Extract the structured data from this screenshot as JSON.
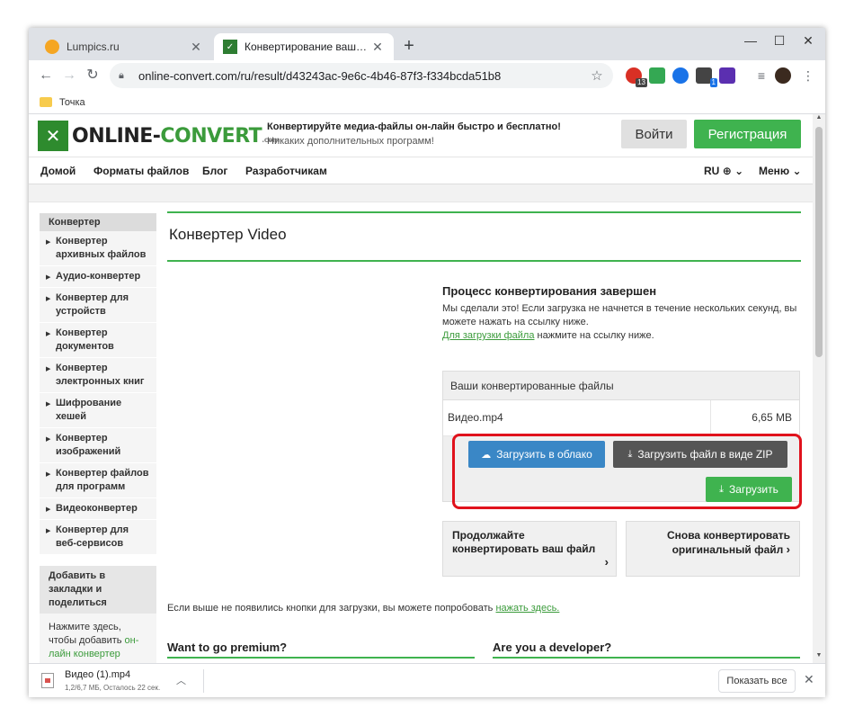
{
  "browser": {
    "tabs": [
      {
        "title": "Lumpics.ru",
        "active": false
      },
      {
        "title": "Конвертирование ваших файлов",
        "active": true
      }
    ],
    "new_tab": "+",
    "window_controls": {
      "minimize": "—",
      "maximize": "☐",
      "close": "✕"
    },
    "url": "online-convert.com/ru/result/d43243ac-9e6c-4b46-87f3-f334bcda51b8",
    "extension_badges": {
      "first": "13",
      "second": "1"
    },
    "bookmarks": [
      {
        "label": "Точка"
      }
    ]
  },
  "site": {
    "logo": {
      "part1": "ONLINE-",
      "part2": "CONVERT",
      "suffix": ".com"
    },
    "tagline_main": "Конвертируйте медиа-файлы он-лайн быстро и бесплатно!",
    "tagline_sub": "Никаких дополнительных программ!",
    "login_label": "Войти",
    "register_label": "Регистрация",
    "nav": {
      "home": "Домой",
      "formats": "Форматы файлов",
      "blog": "Блог",
      "developers": "Разработчикам",
      "lang": "RU",
      "menu": "Меню"
    }
  },
  "sidebar": {
    "heading": "Конвертер",
    "items": [
      {
        "label": "Конвертер архивных файлов"
      },
      {
        "label": "Аудио-конвертер"
      },
      {
        "label": "Конвертер для устройств"
      },
      {
        "label": "Конвертер документов"
      },
      {
        "label": "Конвертер электронных книг"
      },
      {
        "label": "Шифрование хешей"
      },
      {
        "label": "Конвертер изображений"
      },
      {
        "label": "Конвертер файлов для программ"
      },
      {
        "label": "Видеоконвертер"
      },
      {
        "label": "Конвертер для веб-сервисов"
      }
    ],
    "share_heading": "Добавить в закладки и поделиться",
    "share_text": "Нажмите здесь, чтобы добавить ",
    "share_link": "он-лайн конвертер"
  },
  "main": {
    "title": "Конвертер Video",
    "done_title": "Процесс конвертирования завершен",
    "done_text": "Мы сделали это! Если загрузка не начнется в течение нескольких секунд, вы можете нажать на ссылку ниже.",
    "done_link": "Для загрузки файла",
    "done_link_suffix": " нажмите на ссылку ниже.",
    "files_heading": "Ваши конвертированные файлы",
    "file": {
      "name": "Видео.mp4",
      "size": "6,65 MB"
    },
    "btn_cloud": "Загрузить в облако",
    "btn_zip": "Загрузить файл в виде ZIP",
    "btn_download": "Загрузить",
    "card_continue": "Продолжайте конвертировать ваш файл",
    "card_reconvert": "Снова конвертировать оригинальный файл",
    "retry_text": "Если выше не появились кнопки для загрузки, вы можете попробовать ",
    "retry_link": "нажать здесь.",
    "promo_premium": "Want to go premium?",
    "promo_dev": "Are you a developer?"
  },
  "downloads": {
    "file_name": "Видео (1).mp4",
    "status": "1,2/6,7 МБ, Осталось 22 сек.",
    "show_all": "Показать все"
  },
  "colors": {
    "accent_green": "#3fb34f",
    "cloud_blue": "#3a87c6",
    "highlight_red": "#e0121c"
  }
}
